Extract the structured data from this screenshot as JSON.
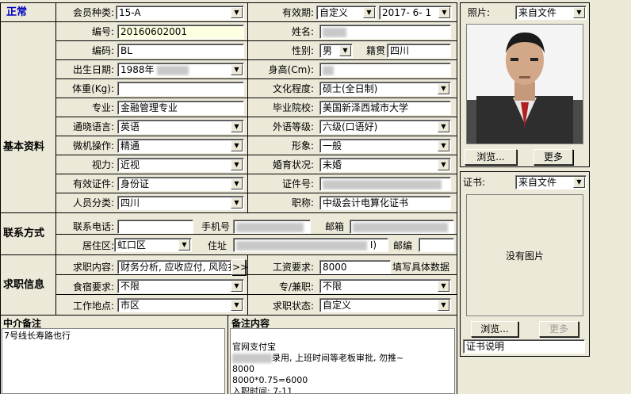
{
  "status_label": "正常",
  "basic": {
    "section_title": "基本资料",
    "member_type_label": "会员种类:",
    "member_type_value": "15-A",
    "validity_label": "有效期:",
    "validity_value": "自定义",
    "validity_date": "2017- 6- 1",
    "id_label": "编号:",
    "id_value": "20160602001",
    "name_label": "姓名:",
    "code_label": "编码:",
    "code_value": "BL",
    "gender_label": "性别:",
    "gender_value": "男",
    "native_label": "籍贯",
    "native_value": "四川",
    "birth_label": "出生日期:",
    "birth_value": "1988年",
    "height_label": "身高(Cm):",
    "weight_label": "体重(Kg):",
    "education_label": "文化程度:",
    "education_value": "硕士(全日制)",
    "major_label": "专业:",
    "major_value": "金融管理专业",
    "school_label": "毕业院校:",
    "school_value": "美国新泽西城市大学",
    "language_label": "通晓语言:",
    "language_value": "英语",
    "lang_level_label": "外语等级:",
    "lang_level_value": "六级(口语好)",
    "computer_label": "微机操作:",
    "computer_value": "精通",
    "appearance_label": "形象:",
    "appearance_value": "一般",
    "vision_label": "视力:",
    "vision_value": "近视",
    "marital_label": "婚育状况:",
    "marital_value": "未婚",
    "idtype_label": "有效证件:",
    "idtype_value": "身份证",
    "idno_label": "证件号:",
    "category_label": "人员分类:",
    "category_value": "四川",
    "title_label": "职称:",
    "title_value": "中级会计电算化证书"
  },
  "contact": {
    "section_title": "联系方式",
    "phone_label": "联系电话:",
    "mobile_label": "手机号",
    "email_label": "邮箱",
    "district_label": "居住区:",
    "district_value": "虹口区",
    "address_label": "住址",
    "address_suffix": "I)",
    "postcode_label": "邮编"
  },
  "job": {
    "section_title": "求职信息",
    "content_label": "求职内容:",
    "content_value": "财务分析, 应收应付, 风险扌",
    "content_btn": ">>",
    "salary_label": "工资要求:",
    "salary_value": "8000",
    "salary_hint": "填写具体数据",
    "lodging_label": "食宿要求:",
    "lodging_value": "不限",
    "parttime_label": "专/兼职:",
    "parttime_value": "不限",
    "location_label": "工作地点:",
    "location_value": "市区",
    "jobstatus_label": "求职状态:",
    "jobstatus_value": "自定义"
  },
  "agency_note": {
    "title": "中介备注",
    "text": "7号线长寿路也行"
  },
  "remark": {
    "title": "备注内容",
    "lines": [
      "官网支付宝",
      "录用, 上班时间等老板审批, 勿推~",
      "8000",
      "8000*0.75=6000",
      "入职时间: 7-11"
    ]
  },
  "photo": {
    "label": "照片:",
    "source": "来自文件",
    "browse": "浏览...",
    "more": "更多"
  },
  "cert": {
    "label": "证书:",
    "source": "来自文件",
    "empty_text": "没有图片",
    "browse": "浏览...",
    "more": "更多",
    "desc": "证书说明"
  }
}
